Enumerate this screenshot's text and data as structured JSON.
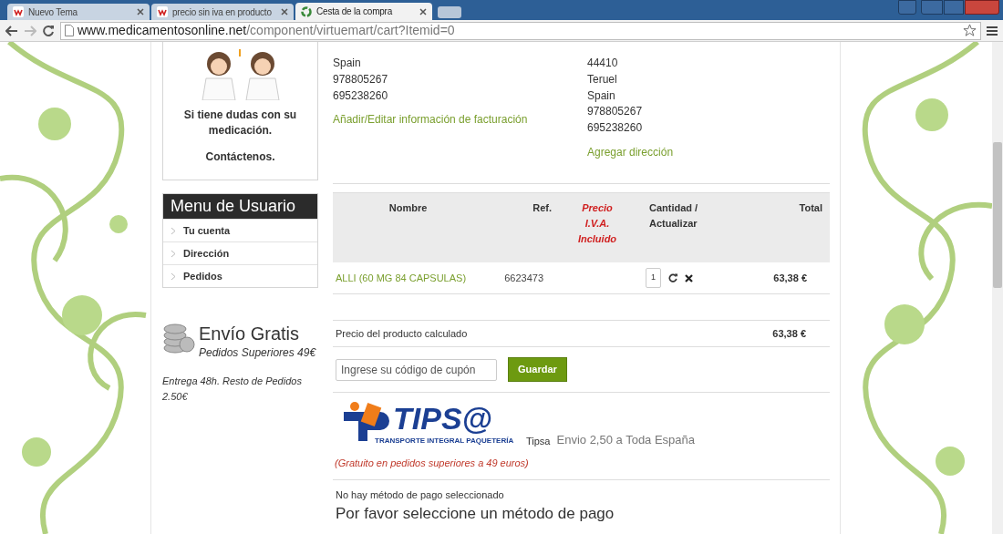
{
  "browser": {
    "tabs": [
      {
        "title": "Nuevo Tema",
        "selected": false
      },
      {
        "title": "precio sin iva en producto",
        "selected": false
      },
      {
        "title": "Cesta de la compra",
        "selected": true
      }
    ],
    "url": {
      "host": "www.medicamentosonline.net",
      "path": "/component/virtuemart/cart?Itemid=0"
    }
  },
  "sidebar": {
    "help_card": {
      "lines": [
        "Si tiene dudas con su medicación.",
        "Contáctenos."
      ]
    },
    "user_menu": {
      "title": "Menu de Usuario",
      "items": [
        "Tu cuenta",
        "Dirección",
        "Pedidos"
      ]
    },
    "shipping_promo": {
      "title": "Envío Gratis",
      "subtitle": "Pedidos Superiores 49€",
      "note": "Entrega 48h. Resto de Pedidos 2.50€"
    }
  },
  "billing": {
    "lines": [
      "Spain",
      "978805267",
      "695238260"
    ],
    "link": "Añadir/Editar información de facturación"
  },
  "shipping_address": {
    "lines": [
      "44410",
      "Teruel",
      "Spain",
      "978805267",
      "695238260"
    ],
    "link": "Agregar dirección"
  },
  "cart": {
    "columns": [
      {
        "label": "Nombre",
        "kind": "plain"
      },
      {
        "label": "Ref.",
        "kind": "plain"
      },
      {
        "label": "Precio I.V.A. Incluido",
        "kind": "highlight"
      },
      {
        "label": "Cantidad / Actualizar",
        "kind": "plain"
      },
      {
        "label": "Total",
        "kind": "plain"
      }
    ],
    "rows": [
      {
        "name": "ALLI (60 MG 84 CAPSULAS)",
        "ref": "6623473",
        "quantity": "1",
        "total": "63,38 €"
      }
    ],
    "subtotal": {
      "label": "Precio del producto calculado",
      "value": "63,38 €"
    },
    "coupon": {
      "placeholder": "Ingrese su código de cupón",
      "button": "Guardar"
    },
    "shipment": {
      "logo_text": "TIPS@",
      "logo_tagline": "TRANSPORTE INTEGRAL PAQUETERÍA",
      "carrier": "Tipsa",
      "description": "Envio 2,50 a Toda España",
      "note": "(Gratuito en pedidos superiores a 49 euros)"
    },
    "payment": {
      "message": "No hay método de pago seleccionado",
      "heading": "Por favor seleccione un método de pago"
    }
  }
}
